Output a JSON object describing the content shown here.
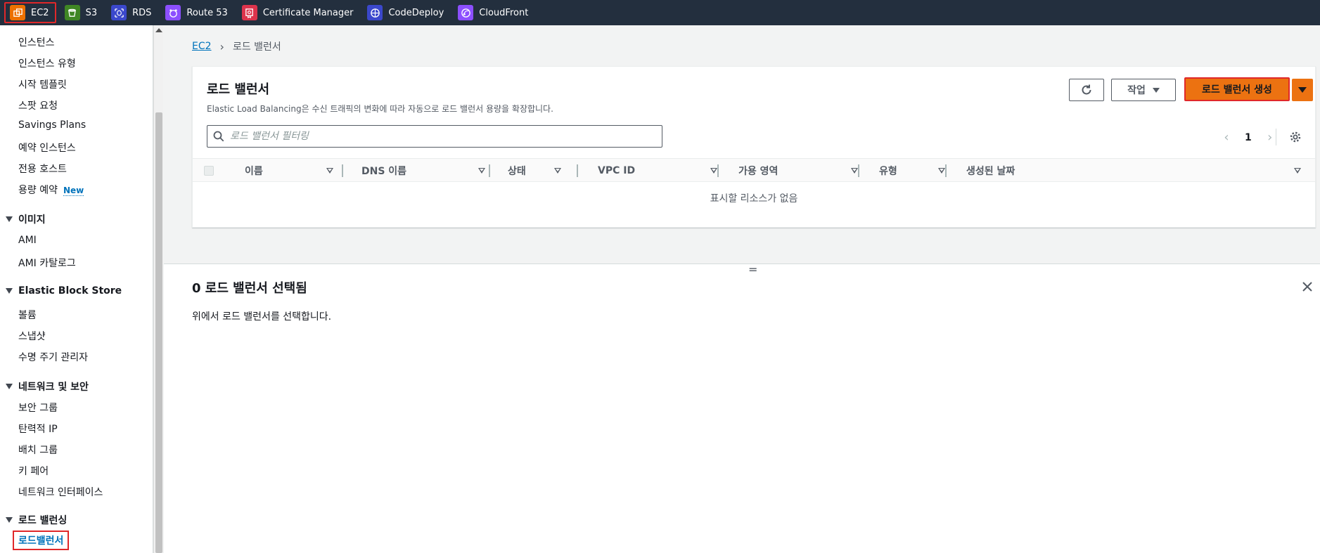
{
  "services": [
    {
      "label": "EC2",
      "icon": "ec2-icon",
      "color": "#ed7100",
      "active": true
    },
    {
      "label": "S3",
      "icon": "s3-icon",
      "color": "#3f8624",
      "active": false
    },
    {
      "label": "RDS",
      "icon": "rds-icon",
      "color": "#3b48cc",
      "active": false
    },
    {
      "label": "Route 53",
      "icon": "route53-icon",
      "color": "#8c4fff",
      "active": false
    },
    {
      "label": "Certificate Manager",
      "icon": "certificate-manager-icon",
      "color": "#dd344c",
      "active": false
    },
    {
      "label": "CodeDeploy",
      "icon": "codedeploy-icon",
      "color": "#3b48cc",
      "active": false
    },
    {
      "label": "CloudFront",
      "icon": "cloudfront-icon",
      "color": "#8c4fff",
      "active": false
    }
  ],
  "sidebar": {
    "instances": [
      "인스턴스",
      "인스턴스 유형",
      "시작 템플릿",
      "스팟 요청",
      "Savings Plans",
      "예약 인스턴스",
      "전용 호스트"
    ],
    "capacity": {
      "label": "용량 예약",
      "badge": "New"
    },
    "images": {
      "title": "이미지",
      "items": [
        "AMI",
        "AMI 카탈로그"
      ]
    },
    "ebs": {
      "title": "Elastic Block Store",
      "items": [
        "볼륨",
        "스냅샷",
        "수명 주기 관리자"
      ]
    },
    "network": {
      "title": "네트워크 및 보안",
      "items": [
        "보안 그룹",
        "탄력적 IP",
        "배치 그룹",
        "키 페어",
        "네트워크 인터페이스"
      ]
    },
    "lb": {
      "title": "로드 밸런싱",
      "active_item": "로드밸런서"
    }
  },
  "breadcrumb": {
    "root": "EC2",
    "current": "로드 밸런서"
  },
  "panel": {
    "title": "로드 밸런서",
    "description": "Elastic Load Balancing은 수신 트래픽의 변화에 따라 자동으로 로드 밸런서 용량을 확장합니다.",
    "actions_label": "작업",
    "create_label": "로드 밸런서 생성",
    "search_placeholder": "로드 밸런서 필터링",
    "page": "1",
    "columns": [
      "이름",
      "DNS 이름",
      "상태",
      "VPC ID",
      "가용 영역",
      "유형",
      "생성된 날짜"
    ],
    "empty_text": "표시할 리소스가 없음"
  },
  "detail": {
    "handle": "=",
    "title": "0 로드 밸런서 선택됨",
    "description": "위에서 로드 밸런서를 선택합니다."
  },
  "colors": {
    "topbar": "#232f3e",
    "primary": "#ec7211",
    "link": "#0073bb",
    "highlight": "#e0282a"
  }
}
